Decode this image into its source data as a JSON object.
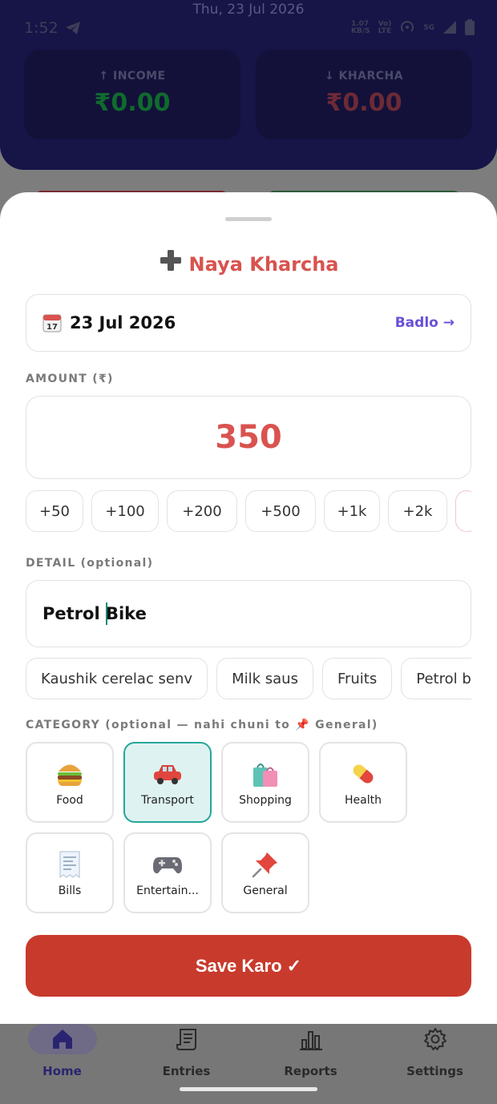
{
  "status_bar": {
    "date_banner": "Thu, 23 Jul 2026",
    "time": "1:52",
    "speed_top": "1.07",
    "speed_bottom": "KB/S",
    "net_top": "Vo)",
    "net_bottom": "LTE",
    "network": "5G"
  },
  "summary": {
    "income_label": "↑ INCOME",
    "income_value": "₹0.00",
    "expense_label": "↓ KHARCHA",
    "expense_value": "₹0.00"
  },
  "sheet": {
    "title": "Naya Kharcha",
    "date_value": "23 Jul 2026",
    "change_date_label": "Badlo →",
    "amount_label": "AMOUNT (₹)",
    "amount_value": "350",
    "quick_amounts": [
      "+50",
      "+100",
      "+200",
      "+500",
      "+1k",
      "+2k"
    ],
    "detail_label": "DETAIL (optional)",
    "detail_before_cursor": "Petrol ",
    "detail_after_cursor": "Bike",
    "suggestions": [
      "Kaushik cerelac senv",
      "Milk saus",
      "Fruits",
      "Petrol bik"
    ],
    "category_label": "CATEGORY (optional — nahi chuni to 📌 General)",
    "categories": [
      {
        "label": "Food",
        "icon": "burger-icon",
        "selected": false
      },
      {
        "label": "Transport",
        "icon": "car-icon",
        "selected": true
      },
      {
        "label": "Shopping",
        "icon": "shopping-bags-icon",
        "selected": false
      },
      {
        "label": "Health",
        "icon": "pill-icon",
        "selected": false
      },
      {
        "label": "Bills",
        "icon": "receipt-icon",
        "selected": false
      },
      {
        "label": "Entertain...",
        "icon": "gamepad-icon",
        "selected": false
      },
      {
        "label": "General",
        "icon": "pushpin-icon",
        "selected": false
      }
    ],
    "save_label": "Save Karo ✓"
  },
  "nav": {
    "home": "Home",
    "entries": "Entries",
    "reports": "Reports",
    "settings": "Settings"
  },
  "colors": {
    "accent_red": "#d9534f",
    "save_button": "#c83a2c",
    "link_purple": "#6a4fd8",
    "selected_teal": "#26a69a"
  }
}
